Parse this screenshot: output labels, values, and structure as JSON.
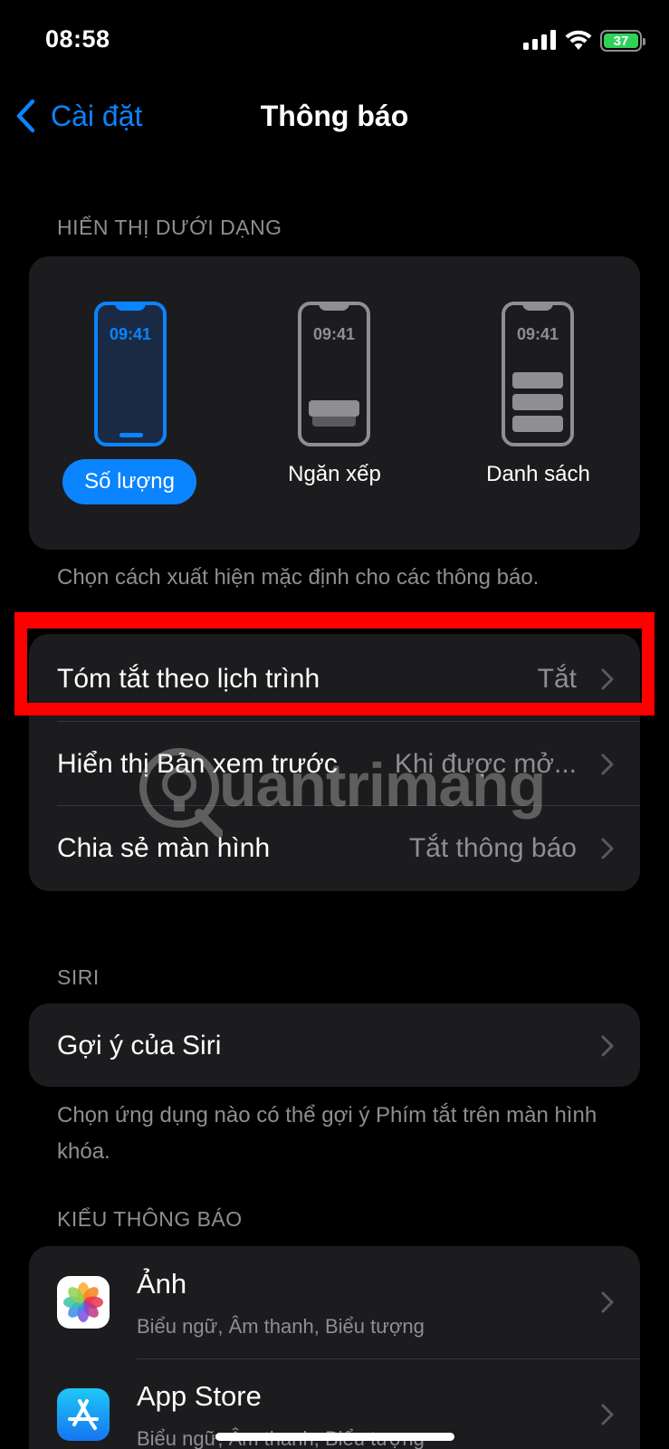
{
  "status": {
    "time": "08:58",
    "battery": "37"
  },
  "nav": {
    "back_label": "Cài đặt",
    "title": "Thông báo"
  },
  "display": {
    "header": "HIỂN THỊ DƯỚI DẠNG",
    "options": [
      {
        "label": "Số lượng",
        "time": "09:41",
        "selected": true
      },
      {
        "label": "Ngăn xếp",
        "time": "09:41",
        "selected": false
      },
      {
        "label": "Danh sách",
        "time": "09:41",
        "selected": false
      }
    ],
    "footer": "Chọn cách xuất hiện mặc định cho các thông báo."
  },
  "settings": [
    {
      "label": "Tóm tắt theo lịch trình",
      "value": "Tắt"
    },
    {
      "label": "Hiển thị Bản xem trước",
      "value": "Khi được mở..."
    },
    {
      "label": "Chia sẻ màn hình",
      "value": "Tắt thông báo"
    }
  ],
  "siri": {
    "header": "SIRI",
    "suggestions_label": "Gợi ý của Siri",
    "footer": "Chọn ứng dụng nào có thể gợi ý Phím tắt trên màn hình khóa."
  },
  "notification_style": {
    "header": "KIỂU THÔNG BÁO",
    "apps": [
      {
        "name": "Ảnh",
        "detail": "Biểu ngữ, Âm thanh, Biểu tượng",
        "icon": "photos-icon"
      },
      {
        "name": "App Store",
        "detail": "Biểu ngữ, Âm thanh, Biểu tượng",
        "icon": "app-store-icon"
      }
    ]
  },
  "watermark": {
    "text": "uantrimang"
  },
  "colors": {
    "accent": "#0a84ff",
    "highlight": "#ff0000",
    "battery": "#30d158"
  }
}
